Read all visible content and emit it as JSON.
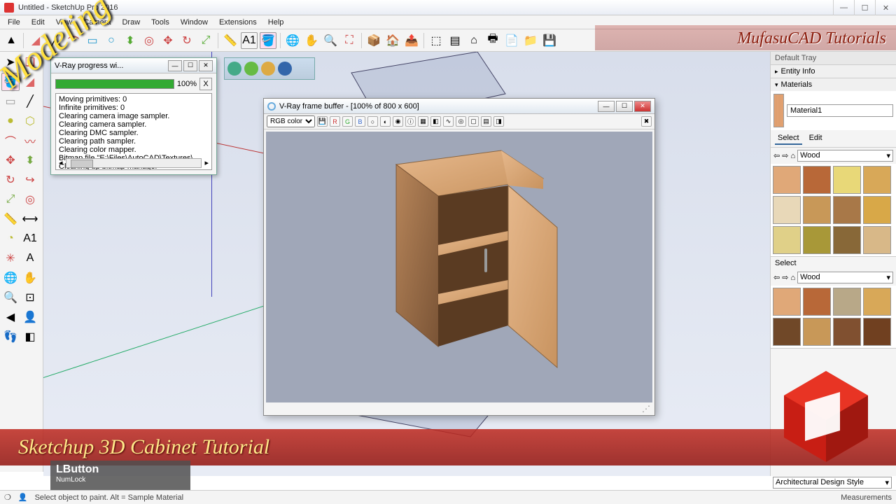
{
  "window": {
    "title": "Untitled - SketchUp Pro 2016",
    "min": "—",
    "max": "☐",
    "close": "✕"
  },
  "menu": [
    "File",
    "Edit",
    "View",
    "Camera",
    "Draw",
    "Tools",
    "Window",
    "Extensions",
    "Help"
  ],
  "progress": {
    "title": "V-Ray progress wi...",
    "percent": "100%",
    "cancel": "X",
    "log": [
      "Moving primitives: 0",
      "Infinite primitives: 0",
      "Clearing camera image sampler.",
      "Clearing camera sampler.",
      "Clearing DMC sampler.",
      "Clearing path sampler.",
      "Clearing color mapper.",
      "Bitmap file \"E:\\Files\\AutoCAD\\Textures\\...",
      "Cleaning up bitmap manager"
    ],
    "log_scroll_left": "◂",
    "log_scroll_right": "▸",
    "log_scroll_marker": "III"
  },
  "vfb": {
    "title": "V-Ray frame buffer - [100% of 800 x 600]",
    "channel": "RGB color",
    "min": "—",
    "max": "☐",
    "close": "✕",
    "btn_r": "R",
    "btn_g": "G",
    "btn_b": "B",
    "resize_glyph": "⋰"
  },
  "tray": {
    "default": "Default Tray",
    "entity": "Entity Info",
    "materials": "Materials",
    "mat_name": "Material1",
    "tab_select": "Select",
    "tab_edit": "Edit",
    "collection": "Wood",
    "dropdown_glyph": "▾",
    "select2": "Select",
    "nav_back": "⇦",
    "nav_fwd": "⇨",
    "nav_home": "⌂"
  },
  "swatches": [
    "#e0a878",
    "#b86838",
    "#e8d878",
    "#d8a858",
    "#e8d8b8",
    "#c89858",
    "#a87848",
    "#d8a848",
    "#e0d088",
    "#a89838",
    "#886838",
    "#d8b888"
  ],
  "swatches2": [
    "#e0a878",
    "#b86838",
    "#b8a888",
    "#d8a858",
    "#704828",
    "#c89858",
    "#805030",
    "#704020"
  ],
  "banner": "Sketchup 3D Cabinet Tutorial",
  "modeling": "Modeling",
  "watermark": "MufasuCAD Tutorials",
  "key": {
    "button": "LButton",
    "lock": "NumLock"
  },
  "status": {
    "hint": "Select object to paint. Alt = Sample Material",
    "meas_label": "Measurements"
  },
  "style": "Architectural Design Style"
}
